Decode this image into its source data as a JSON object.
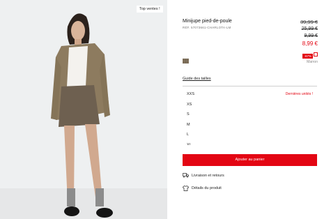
{
  "photo": {
    "badge": "Top ventes !"
  },
  "product": {
    "title": "Minijupe pied-de-poule",
    "ref": "RÉF. 57073661-CHARLOTA-LM",
    "prices": {
      "old1": "39,99 €",
      "old2": "25,99 €",
      "old3": "9,99 €",
      "current": "8,99 €",
      "discount": "-67%"
    },
    "color": {
      "name": "Marron",
      "swatch": "#7a6b55"
    }
  },
  "size_guide": "Guide des tailles",
  "sizes": [
    {
      "label": "XXS",
      "note": "Dernières unités !"
    },
    {
      "label": "XS",
      "note": ""
    },
    {
      "label": "S",
      "note": ""
    },
    {
      "label": "M",
      "note": ""
    },
    {
      "label": "L",
      "note": ""
    },
    {
      "label": "XL",
      "note": ""
    }
  ],
  "add_to_cart": "Ajouter au panier",
  "links": {
    "delivery": "Livraison et retours",
    "details": "Détails du produit"
  },
  "colors": {
    "accent": "#e30613"
  }
}
